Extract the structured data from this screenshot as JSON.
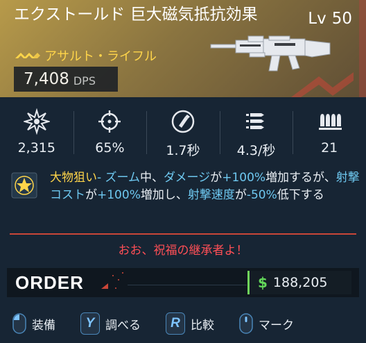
{
  "item": {
    "name": "エクストールド 巨大磁気抵抗効果",
    "level_prefix": "Lv",
    "level": "50",
    "type": "アサルト・ライフル",
    "dps_value": "7,408",
    "dps_label": "DPS"
  },
  "stats": [
    {
      "icon": "impact-damage-icon",
      "value": "2,315"
    },
    {
      "icon": "crosshair-icon",
      "value": "65%"
    },
    {
      "icon": "reload-icon",
      "value": "1.7秒"
    },
    {
      "icon": "fire-rate-icon",
      "value": "4.3/秒"
    },
    {
      "icon": "magazine-icon",
      "value": "21"
    }
  ],
  "perk": {
    "name": "大物狙い",
    "sep": "- ",
    "t1": "ズーム",
    "t2": "中、",
    "t3": "ダメージ",
    "t4": "が",
    "t5": "+100%",
    "t6": "増加するが、",
    "t7": "射撃コスト",
    "t8": "が",
    "t9": "+100%",
    "t10": "増加し、",
    "t11": "射撃速度",
    "t12": "が",
    "t13": "-50%",
    "t14": "低下する"
  },
  "flavor": "おお、祝福の継承者よ！",
  "manufacturer": "ORDER",
  "price": {
    "symbol": "$",
    "value": "188,205"
  },
  "actions": [
    {
      "key_type": "mouse",
      "label": "装備"
    },
    {
      "key_type": "key",
      "key": "Y",
      "label": "調べる"
    },
    {
      "key_type": "key",
      "key": "R",
      "label": "比較"
    },
    {
      "key_type": "mouse",
      "label": "マーク"
    }
  ],
  "colors": {
    "accent_gold": "#ffd54a",
    "keyword_blue": "#6ec8f0",
    "flavor_red": "#ff4f56",
    "price_green": "#63d85a"
  }
}
